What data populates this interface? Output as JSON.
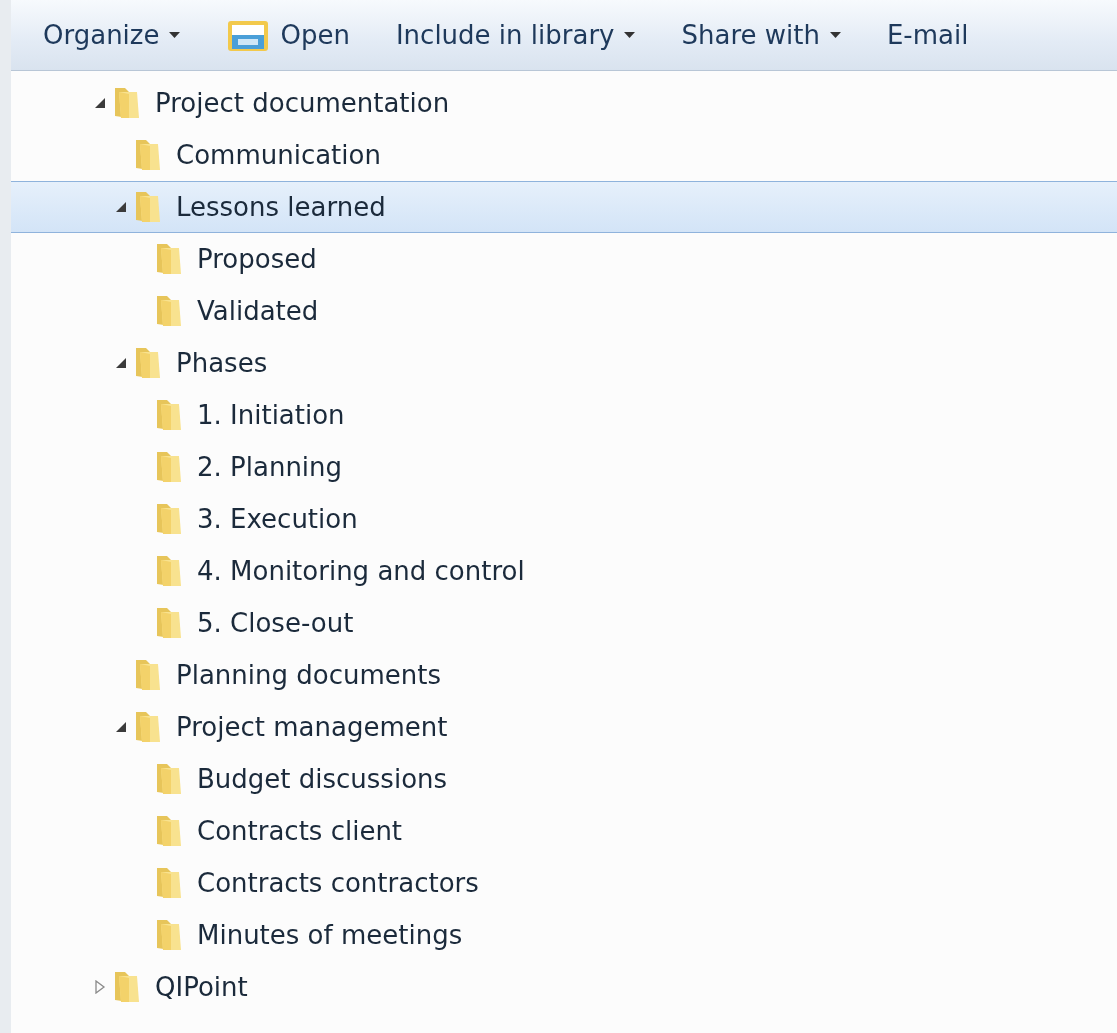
{
  "toolbar": [
    {
      "label": "Organize",
      "kind": "menu"
    },
    {
      "label": "Open",
      "kind": "open"
    },
    {
      "label": "Include in library",
      "kind": "menu"
    },
    {
      "label": "Share with",
      "kind": "menu"
    },
    {
      "label": "E-mail",
      "kind": "plain"
    }
  ],
  "tree": [
    {
      "label": "Project documentation",
      "expanded": true,
      "selected": false,
      "children": [
        {
          "label": "Communication",
          "selected": false
        },
        {
          "label": "Lessons learned",
          "expanded": true,
          "selected": true,
          "children": [
            {
              "label": "Proposed",
              "selected": false
            },
            {
              "label": "Validated",
              "selected": false
            }
          ]
        },
        {
          "label": "Phases",
          "expanded": true,
          "selected": false,
          "children": [
            {
              "label": "1. Initiation",
              "selected": false
            },
            {
              "label": "2. Planning",
              "selected": false
            },
            {
              "label": "3. Execution",
              "selected": false
            },
            {
              "label": "4. Monitoring and control",
              "selected": false
            },
            {
              "label": "5. Close-out",
              "selected": false
            }
          ]
        },
        {
          "label": "Planning documents",
          "selected": false
        },
        {
          "label": "Project management",
          "expanded": true,
          "selected": false,
          "children": [
            {
              "label": "Budget discussions",
              "selected": false
            },
            {
              "label": "Contracts client",
              "selected": false
            },
            {
              "label": "Contracts contractors",
              "selected": false
            },
            {
              "label": "Minutes of meetings",
              "selected": false
            }
          ]
        }
      ]
    },
    {
      "label": "QIPoint",
      "expanded": false,
      "selected": false
    }
  ]
}
